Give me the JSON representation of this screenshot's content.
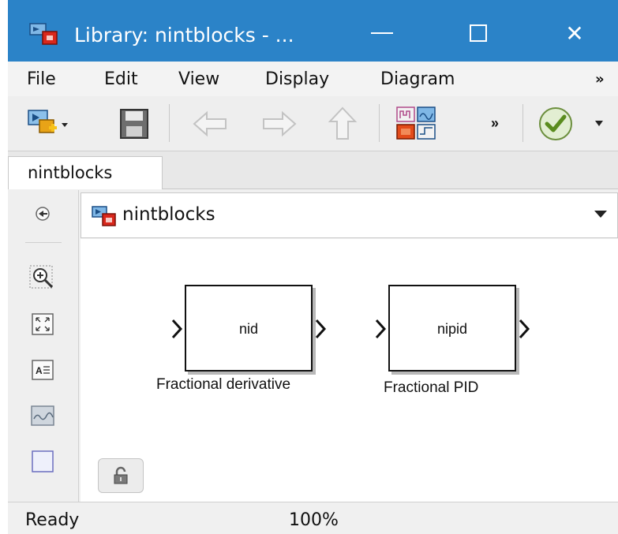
{
  "window": {
    "title": "Library: nintblocks - ...",
    "controls": {
      "minimize": "—",
      "maximize": "☐",
      "close": "✕"
    }
  },
  "menubar": {
    "items": [
      "File",
      "Edit",
      "View",
      "Display",
      "Diagram"
    ],
    "more": "»"
  },
  "toolbar": {
    "buttons": [
      "new-library-icon",
      "save-icon",
      "back-arrow-icon",
      "forward-arrow-icon",
      "up-arrow-icon",
      "library-browser-icon",
      "check-icon"
    ],
    "more": "»"
  },
  "tabs": [
    {
      "label": "nintblocks"
    }
  ],
  "addressbar": {
    "path": "nintblocks"
  },
  "palette": {
    "buttons": [
      "hide-explorer-icon",
      "zoom-in-icon",
      "fit-to-view-icon",
      "text-annotation-icon",
      "image-icon",
      "area-icon"
    ]
  },
  "canvas": {
    "blocks": [
      {
        "label": "nid",
        "name": "Fractional derivative"
      },
      {
        "label": "nipid",
        "name": "Fractional PID"
      }
    ]
  },
  "statusbar": {
    "status": "Ready",
    "zoom": "100%"
  },
  "colors": {
    "titlebar": "#2b83c8",
    "canvas": "#ffffff",
    "chrome": "#f0f0f0"
  }
}
